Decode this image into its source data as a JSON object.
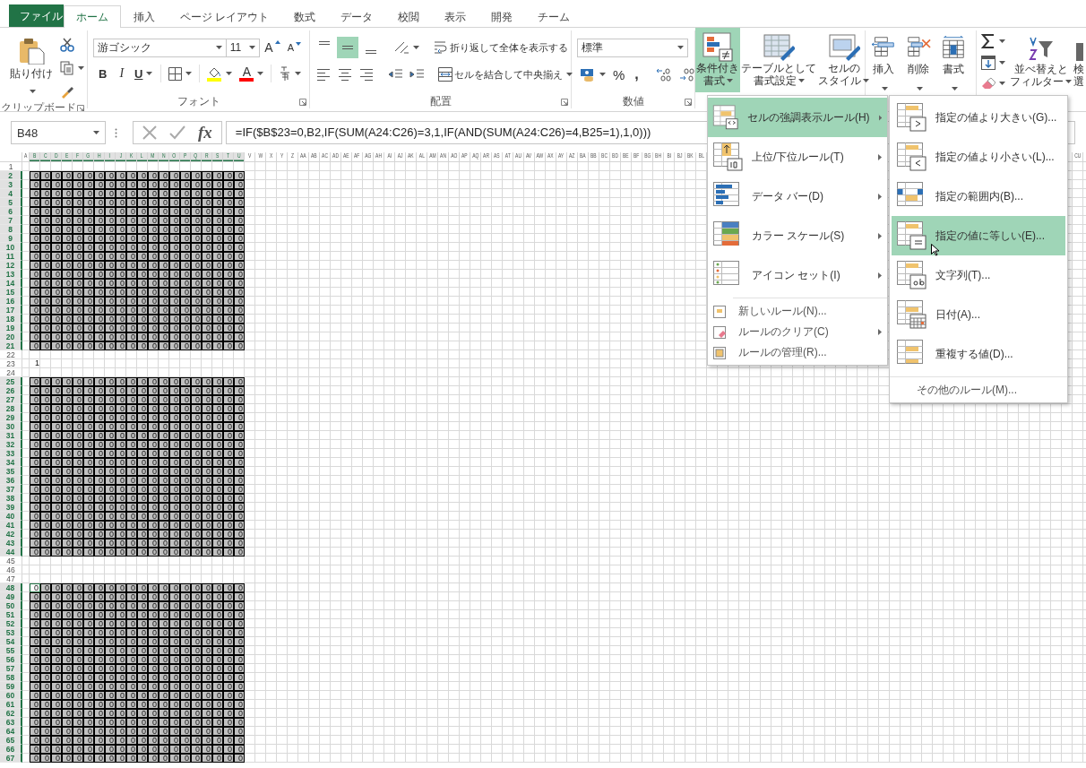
{
  "tabs": [
    {
      "label": "ファイル",
      "kind": "file",
      "selected": false
    },
    {
      "label": "ホーム",
      "kind": "tab",
      "selected": true
    },
    {
      "label": "挿入",
      "kind": "tab",
      "selected": false
    },
    {
      "label": "ページ レイアウト",
      "kind": "tab",
      "selected": false
    },
    {
      "label": "数式",
      "kind": "tab",
      "selected": false
    },
    {
      "label": "データ",
      "kind": "tab",
      "selected": false
    },
    {
      "label": "校閲",
      "kind": "tab",
      "selected": false
    },
    {
      "label": "表示",
      "kind": "tab",
      "selected": false
    },
    {
      "label": "開発",
      "kind": "tab",
      "selected": false
    },
    {
      "label": "チーム",
      "kind": "tab",
      "selected": false
    }
  ],
  "ribbon": {
    "clipboard": {
      "paste": "貼り付け",
      "group_label": "クリップボード"
    },
    "font": {
      "font_name": "游ゴシック",
      "font_size": "11",
      "grow": "A",
      "shrink": "A",
      "bold": "B",
      "italic": "I",
      "underline": "U",
      "font_color": "A",
      "group_label": "フォント"
    },
    "alignment": {
      "vertical": [
        {
          "selected": false
        },
        {
          "selected": true
        },
        {
          "selected": false
        }
      ],
      "wrap_text": "折り返して全体を表示する",
      "merge": "セルを結合して中央揃え",
      "group_label": "配置"
    },
    "number": {
      "format": "標準",
      "percent": "%",
      "comma": ",",
      "group_label": "数値"
    },
    "styles": [
      {
        "lines": [
          "条件付き",
          "書式"
        ],
        "selected": true
      },
      {
        "lines": [
          "テーブルとして",
          "書式設定"
        ],
        "selected": false
      },
      {
        "lines": [
          "セルの",
          "スタイル"
        ],
        "selected": false
      }
    ],
    "cells": [
      {
        "label": "挿入"
      },
      {
        "label": "削除"
      },
      {
        "label": "書式"
      }
    ],
    "editing": {
      "sort": [
        "並べ替えと",
        "フィルター"
      ],
      "find": [
        "検",
        "選"
      ]
    }
  },
  "formula_bar": {
    "name_box": "B48",
    "function_label": "fx",
    "formula": "=IF($B$23=0,B2,IF(SUM(A24:C26)=3,1,IF(AND(SUM(A24:C26)=4,B25=1),1,0)))"
  },
  "sheet": {
    "column_headers_left": [
      {
        "label": "A",
        "highlighted": false
      },
      {
        "label": "B",
        "highlighted": true
      },
      {
        "label": "C",
        "highlighted": true
      },
      {
        "label": "D",
        "highlighted": true
      },
      {
        "label": "E",
        "highlighted": true
      },
      {
        "label": "F",
        "highlighted": true
      },
      {
        "label": "G",
        "highlighted": true
      },
      {
        "label": "H",
        "highlighted": true
      },
      {
        "label": "I",
        "highlighted": true
      },
      {
        "label": "J",
        "highlighted": true
      },
      {
        "label": "K",
        "highlighted": true
      },
      {
        "label": "L",
        "highlighted": true
      },
      {
        "label": "M",
        "highlighted": true
      },
      {
        "label": "N",
        "highlighted": true
      },
      {
        "label": "O",
        "highlighted": true
      },
      {
        "label": "P",
        "highlighted": true
      },
      {
        "label": "Q",
        "highlighted": true
      },
      {
        "label": "R",
        "highlighted": true
      },
      {
        "label": "S",
        "highlighted": true
      },
      {
        "label": "T",
        "highlighted": true
      },
      {
        "label": "U",
        "highlighted": true
      },
      {
        "label": "V",
        "highlighted": false
      },
      {
        "label": "W",
        "highlighted": false
      },
      {
        "label": "X",
        "highlighted": false
      },
      {
        "label": "Y",
        "highlighted": false
      },
      {
        "label": "Z",
        "highlighted": false
      },
      {
        "label": "AA",
        "highlighted": false
      },
      {
        "label": "AB",
        "highlighted": false
      },
      {
        "label": "AC",
        "highlighted": false
      },
      {
        "label": "AD",
        "highlighted": false
      },
      {
        "label": "AE",
        "highlighted": false
      },
      {
        "label": "AF",
        "highlighted": false
      },
      {
        "label": "AG",
        "highlighted": false
      },
      {
        "label": "AH",
        "highlighted": false
      },
      {
        "label": "AI",
        "highlighted": false
      },
      {
        "label": "AJ",
        "highlighted": false
      },
      {
        "label": "AK",
        "highlighted": false
      },
      {
        "label": "AL",
        "highlighted": false
      },
      {
        "label": "AM",
        "highlighted": false
      },
      {
        "label": "AN",
        "highlighted": false
      },
      {
        "label": "AO",
        "highlighted": false
      },
      {
        "label": "AP",
        "highlighted": false
      },
      {
        "label": "AQ",
        "highlighted": false
      },
      {
        "label": "AR",
        "highlighted": false
      },
      {
        "label": "AS",
        "highlighted": false
      },
      {
        "label": "AT",
        "highlighted": false
      },
      {
        "label": "AU",
        "highlighted": false
      },
      {
        "label": "AV",
        "highlighted": false
      },
      {
        "label": "AW",
        "highlighted": false
      },
      {
        "label": "AX",
        "highlighted": false
      },
      {
        "label": "AY",
        "highlighted": false
      },
      {
        "label": "AZ",
        "highlighted": false
      },
      {
        "label": "BA",
        "highlighted": false
      },
      {
        "label": "BB",
        "highlighted": false
      },
      {
        "label": "BC",
        "highlighted": false
      },
      {
        "label": "BD",
        "highlighted": false
      },
      {
        "label": "BE",
        "highlighted": false
      },
      {
        "label": "BF",
        "highlighted": false
      },
      {
        "label": "BG",
        "highlighted": false
      },
      {
        "label": "BH",
        "highlighted": false
      },
      {
        "label": "BI",
        "highlighted": false
      },
      {
        "label": "BJ",
        "highlighted": false
      },
      {
        "label": "BK",
        "highlighted": false
      },
      {
        "label": "BL",
        "highlighted": false
      }
    ],
    "column_headers_right": [
      {
        "label": "CU",
        "highlighted": false
      }
    ],
    "rows": [
      {
        "header": "1",
        "highlighted": false,
        "shaded": false
      },
      {
        "header": "2",
        "highlighted": true,
        "shaded": true,
        "first_cell_selected": false,
        "cells": [
          "0",
          "0",
          "0",
          "0",
          "0",
          "0",
          "0",
          "0",
          "0",
          "0",
          "0",
          "0",
          "0",
          "0",
          "0",
          "0",
          "0",
          "0",
          "0",
          "0"
        ]
      },
      {
        "header": "3",
        "highlighted": true,
        "shaded": true,
        "first_cell_selected": false,
        "cells": [
          "0",
          "0",
          "0",
          "0",
          "0",
          "0",
          "0",
          "0",
          "0",
          "0",
          "0",
          "0",
          "0",
          "0",
          "0",
          "0",
          "0",
          "0",
          "0",
          "0"
        ]
      },
      {
        "header": "4",
        "highlighted": true,
        "shaded": true,
        "first_cell_selected": false,
        "cells": [
          "0",
          "0",
          "0",
          "0",
          "0",
          "0",
          "0",
          "0",
          "0",
          "0",
          "0",
          "0",
          "0",
          "0",
          "0",
          "0",
          "0",
          "0",
          "0",
          "0"
        ]
      },
      {
        "header": "5",
        "highlighted": true,
        "shaded": true,
        "first_cell_selected": false,
        "cells": [
          "0",
          "0",
          "0",
          "0",
          "0",
          "0",
          "0",
          "0",
          "0",
          "0",
          "0",
          "0",
          "0",
          "0",
          "0",
          "0",
          "0",
          "0",
          "0",
          "0"
        ]
      },
      {
        "header": "6",
        "highlighted": true,
        "shaded": true,
        "first_cell_selected": false,
        "cells": [
          "0",
          "0",
          "0",
          "0",
          "0",
          "0",
          "0",
          "0",
          "0",
          "0",
          "0",
          "0",
          "0",
          "0",
          "0",
          "0",
          "0",
          "0",
          "0",
          "0"
        ]
      },
      {
        "header": "7",
        "highlighted": true,
        "shaded": true,
        "first_cell_selected": false,
        "cells": [
          "0",
          "0",
          "0",
          "0",
          "0",
          "0",
          "0",
          "0",
          "0",
          "0",
          "0",
          "0",
          "0",
          "0",
          "0",
          "0",
          "0",
          "0",
          "0",
          "0"
        ]
      },
      {
        "header": "8",
        "highlighted": true,
        "shaded": true,
        "first_cell_selected": false,
        "cells": [
          "0",
          "0",
          "0",
          "0",
          "0",
          "0",
          "0",
          "0",
          "0",
          "0",
          "0",
          "0",
          "0",
          "0",
          "0",
          "0",
          "0",
          "0",
          "0",
          "0"
        ]
      },
      {
        "header": "9",
        "highlighted": true,
        "shaded": true,
        "first_cell_selected": false,
        "cells": [
          "0",
          "0",
          "0",
          "0",
          "0",
          "0",
          "0",
          "0",
          "0",
          "0",
          "0",
          "0",
          "0",
          "0",
          "0",
          "0",
          "0",
          "0",
          "0",
          "0"
        ]
      },
      {
        "header": "10",
        "highlighted": true,
        "shaded": true,
        "first_cell_selected": false,
        "cells": [
          "0",
          "0",
          "0",
          "0",
          "0",
          "0",
          "0",
          "0",
          "0",
          "0",
          "0",
          "0",
          "0",
          "0",
          "0",
          "0",
          "0",
          "0",
          "0",
          "0"
        ]
      },
      {
        "header": "11",
        "highlighted": true,
        "shaded": true,
        "first_cell_selected": false,
        "cells": [
          "0",
          "0",
          "0",
          "0",
          "0",
          "0",
          "0",
          "0",
          "0",
          "0",
          "0",
          "0",
          "0",
          "0",
          "0",
          "0",
          "0",
          "0",
          "0",
          "0"
        ]
      },
      {
        "header": "12",
        "highlighted": true,
        "shaded": true,
        "first_cell_selected": false,
        "cells": [
          "0",
          "0",
          "0",
          "0",
          "0",
          "0",
          "0",
          "0",
          "0",
          "0",
          "0",
          "0",
          "0",
          "0",
          "0",
          "0",
          "0",
          "0",
          "0",
          "0"
        ]
      },
      {
        "header": "13",
        "highlighted": true,
        "shaded": true,
        "first_cell_selected": false,
        "cells": [
          "0",
          "0",
          "0",
          "0",
          "0",
          "0",
          "0",
          "0",
          "0",
          "0",
          "0",
          "0",
          "0",
          "0",
          "0",
          "0",
          "0",
          "0",
          "0",
          "0"
        ]
      },
      {
        "header": "14",
        "highlighted": true,
        "shaded": true,
        "first_cell_selected": false,
        "cells": [
          "0",
          "0",
          "0",
          "0",
          "0",
          "0",
          "0",
          "0",
          "0",
          "0",
          "0",
          "0",
          "0",
          "0",
          "0",
          "0",
          "0",
          "0",
          "0",
          "0"
        ]
      },
      {
        "header": "15",
        "highlighted": true,
        "shaded": true,
        "first_cell_selected": false,
        "cells": [
          "0",
          "0",
          "0",
          "0",
          "0",
          "0",
          "0",
          "0",
          "0",
          "0",
          "0",
          "0",
          "0",
          "0",
          "0",
          "0",
          "0",
          "0",
          "0",
          "0"
        ]
      },
      {
        "header": "16",
        "highlighted": true,
        "shaded": true,
        "first_cell_selected": false,
        "cells": [
          "0",
          "0",
          "0",
          "0",
          "0",
          "0",
          "0",
          "0",
          "0",
          "0",
          "0",
          "0",
          "0",
          "0",
          "0",
          "0",
          "0",
          "0",
          "0",
          "0"
        ]
      },
      {
        "header": "17",
        "highlighted": true,
        "shaded": true,
        "first_cell_selected": false,
        "cells": [
          "0",
          "0",
          "0",
          "0",
          "0",
          "0",
          "0",
          "0",
          "0",
          "0",
          "0",
          "0",
          "0",
          "0",
          "0",
          "0",
          "0",
          "0",
          "0",
          "0"
        ]
      },
      {
        "header": "18",
        "highlighted": true,
        "shaded": true,
        "first_cell_selected": false,
        "cells": [
          "0",
          "0",
          "0",
          "0",
          "0",
          "0",
          "0",
          "0",
          "0",
          "0",
          "0",
          "0",
          "0",
          "0",
          "0",
          "0",
          "0",
          "0",
          "0",
          "0"
        ]
      },
      {
        "header": "19",
        "highlighted": true,
        "shaded": true,
        "first_cell_selected": false,
        "cells": [
          "0",
          "0",
          "0",
          "0",
          "0",
          "0",
          "0",
          "0",
          "0",
          "0",
          "0",
          "0",
          "0",
          "0",
          "0",
          "0",
          "0",
          "0",
          "0",
          "0"
        ]
      },
      {
        "header": "20",
        "highlighted": true,
        "shaded": true,
        "first_cell_selected": false,
        "cells": [
          "0",
          "0",
          "0",
          "0",
          "0",
          "0",
          "0",
          "0",
          "0",
          "0",
          "0",
          "0",
          "0",
          "0",
          "0",
          "0",
          "0",
          "0",
          "0",
          "0"
        ]
      },
      {
        "header": "21",
        "highlighted": true,
        "shaded": true,
        "first_cell_selected": false,
        "cells": [
          "0",
          "0",
          "0",
          "0",
          "0",
          "0",
          "0",
          "0",
          "0",
          "0",
          "0",
          "0",
          "0",
          "0",
          "0",
          "0",
          "0",
          "0",
          "0",
          "0"
        ]
      },
      {
        "header": "22",
        "highlighted": false,
        "shaded": false
      },
      {
        "header": "23",
        "highlighted": false,
        "shaded": false,
        "first_cell_selected": false,
        "cells": [
          "1"
        ]
      },
      {
        "header": "24",
        "highlighted": false,
        "shaded": false
      },
      {
        "header": "25",
        "highlighted": true,
        "shaded": true,
        "first_cell_selected": false,
        "cells": [
          "0",
          "0",
          "0",
          "0",
          "0",
          "0",
          "0",
          "0",
          "0",
          "0",
          "0",
          "0",
          "0",
          "0",
          "0",
          "0",
          "0",
          "0",
          "0",
          "0"
        ]
      },
      {
        "header": "26",
        "highlighted": true,
        "shaded": true,
        "first_cell_selected": false,
        "cells": [
          "0",
          "0",
          "0",
          "0",
          "0",
          "0",
          "0",
          "0",
          "0",
          "0",
          "0",
          "0",
          "0",
          "0",
          "0",
          "0",
          "0",
          "0",
          "0",
          "0"
        ]
      },
      {
        "header": "27",
        "highlighted": true,
        "shaded": true,
        "first_cell_selected": false,
        "cells": [
          "0",
          "0",
          "0",
          "0",
          "0",
          "0",
          "0",
          "0",
          "0",
          "0",
          "0",
          "0",
          "0",
          "0",
          "0",
          "0",
          "0",
          "0",
          "0",
          "0"
        ]
      },
      {
        "header": "28",
        "highlighted": true,
        "shaded": true,
        "first_cell_selected": false,
        "cells": [
          "0",
          "0",
          "0",
          "0",
          "0",
          "0",
          "0",
          "0",
          "0",
          "0",
          "0",
          "0",
          "0",
          "0",
          "0",
          "0",
          "0",
          "0",
          "0",
          "0"
        ]
      },
      {
        "header": "29",
        "highlighted": true,
        "shaded": true,
        "first_cell_selected": false,
        "cells": [
          "0",
          "0",
          "0",
          "0",
          "0",
          "0",
          "0",
          "0",
          "0",
          "0",
          "0",
          "0",
          "0",
          "0",
          "0",
          "0",
          "0",
          "0",
          "0",
          "0"
        ]
      },
      {
        "header": "30",
        "highlighted": true,
        "shaded": true,
        "first_cell_selected": false,
        "cells": [
          "0",
          "0",
          "0",
          "0",
          "0",
          "0",
          "0",
          "0",
          "0",
          "0",
          "0",
          "0",
          "0",
          "0",
          "0",
          "0",
          "0",
          "0",
          "0",
          "0"
        ]
      },
      {
        "header": "31",
        "highlighted": true,
        "shaded": true,
        "first_cell_selected": false,
        "cells": [
          "0",
          "0",
          "0",
          "0",
          "0",
          "0",
          "0",
          "0",
          "0",
          "0",
          "0",
          "0",
          "0",
          "0",
          "0",
          "0",
          "0",
          "0",
          "0",
          "0"
        ]
      },
      {
        "header": "32",
        "highlighted": true,
        "shaded": true,
        "first_cell_selected": false,
        "cells": [
          "0",
          "0",
          "0",
          "0",
          "0",
          "0",
          "0",
          "0",
          "0",
          "0",
          "0",
          "0",
          "0",
          "0",
          "0",
          "0",
          "0",
          "0",
          "0",
          "0"
        ]
      },
      {
        "header": "33",
        "highlighted": true,
        "shaded": true,
        "first_cell_selected": false,
        "cells": [
          "0",
          "0",
          "0",
          "0",
          "0",
          "0",
          "0",
          "0",
          "0",
          "0",
          "0",
          "0",
          "0",
          "0",
          "0",
          "0",
          "0",
          "0",
          "0",
          "0"
        ]
      },
      {
        "header": "34",
        "highlighted": true,
        "shaded": true,
        "first_cell_selected": false,
        "cells": [
          "0",
          "0",
          "0",
          "0",
          "0",
          "0",
          "0",
          "0",
          "0",
          "0",
          "0",
          "0",
          "0",
          "0",
          "0",
          "0",
          "0",
          "0",
          "0",
          "0"
        ]
      },
      {
        "header": "35",
        "highlighted": true,
        "shaded": true,
        "first_cell_selected": false,
        "cells": [
          "0",
          "0",
          "0",
          "0",
          "0",
          "0",
          "0",
          "0",
          "0",
          "0",
          "0",
          "0",
          "0",
          "0",
          "0",
          "0",
          "0",
          "0",
          "0",
          "0"
        ]
      },
      {
        "header": "36",
        "highlighted": true,
        "shaded": true,
        "first_cell_selected": false,
        "cells": [
          "0",
          "0",
          "0",
          "0",
          "0",
          "0",
          "0",
          "0",
          "0",
          "0",
          "0",
          "0",
          "0",
          "0",
          "0",
          "0",
          "0",
          "0",
          "0",
          "0"
        ]
      },
      {
        "header": "37",
        "highlighted": true,
        "shaded": true,
        "first_cell_selected": false,
        "cells": [
          "0",
          "0",
          "0",
          "0",
          "0",
          "0",
          "0",
          "0",
          "0",
          "0",
          "0",
          "0",
          "0",
          "0",
          "0",
          "0",
          "0",
          "0",
          "0",
          "0"
        ]
      },
      {
        "header": "38",
        "highlighted": true,
        "shaded": true,
        "first_cell_selected": false,
        "cells": [
          "0",
          "0",
          "0",
          "0",
          "0",
          "0",
          "0",
          "0",
          "0",
          "0",
          "0",
          "0",
          "0",
          "0",
          "0",
          "0",
          "0",
          "0",
          "0",
          "0"
        ]
      },
      {
        "header": "39",
        "highlighted": true,
        "shaded": true,
        "first_cell_selected": false,
        "cells": [
          "0",
          "0",
          "0",
          "0",
          "0",
          "0",
          "0",
          "0",
          "0",
          "0",
          "0",
          "0",
          "0",
          "0",
          "0",
          "0",
          "0",
          "0",
          "0",
          "0"
        ]
      },
      {
        "header": "40",
        "highlighted": true,
        "shaded": true,
        "first_cell_selected": false,
        "cells": [
          "0",
          "0",
          "0",
          "0",
          "0",
          "0",
          "0",
          "0",
          "0",
          "0",
          "0",
          "0",
          "0",
          "0",
          "0",
          "0",
          "0",
          "0",
          "0",
          "0"
        ]
      },
      {
        "header": "41",
        "highlighted": true,
        "shaded": true,
        "first_cell_selected": false,
        "cells": [
          "0",
          "0",
          "0",
          "0",
          "0",
          "0",
          "0",
          "0",
          "0",
          "0",
          "0",
          "0",
          "0",
          "0",
          "0",
          "0",
          "0",
          "0",
          "0",
          "0"
        ]
      },
      {
        "header": "42",
        "highlighted": true,
        "shaded": true,
        "first_cell_selected": false,
        "cells": [
          "0",
          "0",
          "0",
          "0",
          "0",
          "0",
          "0",
          "0",
          "0",
          "0",
          "0",
          "0",
          "0",
          "0",
          "0",
          "0",
          "0",
          "0",
          "0",
          "0"
        ]
      },
      {
        "header": "43",
        "highlighted": true,
        "shaded": true,
        "first_cell_selected": false,
        "cells": [
          "0",
          "0",
          "0",
          "0",
          "0",
          "0",
          "0",
          "0",
          "0",
          "0",
          "0",
          "0",
          "0",
          "0",
          "0",
          "0",
          "0",
          "0",
          "0",
          "0"
        ]
      },
      {
        "header": "44",
        "highlighted": true,
        "shaded": true,
        "first_cell_selected": false,
        "cells": [
          "0",
          "0",
          "0",
          "0",
          "0",
          "0",
          "0",
          "0",
          "0",
          "0",
          "0",
          "0",
          "0",
          "0",
          "0",
          "0",
          "0",
          "0",
          "0",
          "0"
        ]
      },
      {
        "header": "45",
        "highlighted": false,
        "shaded": false
      },
      {
        "header": "46",
        "highlighted": false,
        "shaded": false
      },
      {
        "header": "47",
        "highlighted": false,
        "shaded": false
      },
      {
        "header": "48",
        "highlighted": true,
        "shaded": true,
        "first_cell_selected": true,
        "cells": [
          "0",
          "0",
          "0",
          "0",
          "0",
          "0",
          "0",
          "0",
          "0",
          "0",
          "0",
          "0",
          "0",
          "0",
          "0",
          "0",
          "0",
          "0",
          "0",
          "0"
        ]
      },
      {
        "header": "49",
        "highlighted": true,
        "shaded": true,
        "first_cell_selected": false,
        "cells": [
          "0",
          "0",
          "0",
          "0",
          "0",
          "0",
          "0",
          "0",
          "0",
          "0",
          "0",
          "0",
          "0",
          "0",
          "0",
          "0",
          "0",
          "0",
          "0",
          "0"
        ]
      },
      {
        "header": "50",
        "highlighted": true,
        "shaded": true,
        "first_cell_selected": false,
        "cells": [
          "0",
          "0",
          "0",
          "0",
          "0",
          "0",
          "0",
          "0",
          "0",
          "0",
          "0",
          "0",
          "0",
          "0",
          "0",
          "0",
          "0",
          "0",
          "0",
          "0"
        ]
      },
      {
        "header": "51",
        "highlighted": true,
        "shaded": true,
        "first_cell_selected": false,
        "cells": [
          "0",
          "0",
          "0",
          "0",
          "0",
          "0",
          "0",
          "0",
          "0",
          "0",
          "0",
          "0",
          "0",
          "0",
          "0",
          "0",
          "0",
          "0",
          "0",
          "0"
        ]
      },
      {
        "header": "52",
        "highlighted": true,
        "shaded": true,
        "first_cell_selected": false,
        "cells": [
          "0",
          "0",
          "0",
          "0",
          "0",
          "0",
          "0",
          "0",
          "0",
          "0",
          "0",
          "0",
          "0",
          "0",
          "0",
          "0",
          "0",
          "0",
          "0",
          "0"
        ]
      },
      {
        "header": "53",
        "highlighted": true,
        "shaded": true,
        "first_cell_selected": false,
        "cells": [
          "0",
          "0",
          "0",
          "0",
          "0",
          "0",
          "0",
          "0",
          "0",
          "0",
          "0",
          "0",
          "0",
          "0",
          "0",
          "0",
          "0",
          "0",
          "0",
          "0"
        ]
      },
      {
        "header": "54",
        "highlighted": true,
        "shaded": true,
        "first_cell_selected": false,
        "cells": [
          "0",
          "0",
          "0",
          "0",
          "0",
          "0",
          "0",
          "0",
          "0",
          "0",
          "0",
          "0",
          "0",
          "0",
          "0",
          "0",
          "0",
          "0",
          "0",
          "0"
        ]
      },
      {
        "header": "55",
        "highlighted": true,
        "shaded": true,
        "first_cell_selected": false,
        "cells": [
          "0",
          "0",
          "0",
          "0",
          "0",
          "0",
          "0",
          "0",
          "0",
          "0",
          "0",
          "0",
          "0",
          "0",
          "0",
          "0",
          "0",
          "0",
          "0",
          "0"
        ]
      },
      {
        "header": "56",
        "highlighted": true,
        "shaded": true,
        "first_cell_selected": false,
        "cells": [
          "0",
          "0",
          "0",
          "0",
          "0",
          "0",
          "0",
          "0",
          "0",
          "0",
          "0",
          "0",
          "0",
          "0",
          "0",
          "0",
          "0",
          "0",
          "0",
          "0"
        ]
      },
      {
        "header": "57",
        "highlighted": true,
        "shaded": true,
        "first_cell_selected": false,
        "cells": [
          "0",
          "0",
          "0",
          "0",
          "0",
          "0",
          "0",
          "0",
          "0",
          "0",
          "0",
          "0",
          "0",
          "0",
          "0",
          "0",
          "0",
          "0",
          "0",
          "0"
        ]
      },
      {
        "header": "58",
        "highlighted": true,
        "shaded": true,
        "first_cell_selected": false,
        "cells": [
          "0",
          "0",
          "0",
          "0",
          "0",
          "0",
          "0",
          "0",
          "0",
          "0",
          "0",
          "0",
          "0",
          "0",
          "0",
          "0",
          "0",
          "0",
          "0",
          "0"
        ]
      },
      {
        "header": "59",
        "highlighted": true,
        "shaded": true,
        "first_cell_selected": false,
        "cells": [
          "0",
          "0",
          "0",
          "0",
          "0",
          "0",
          "0",
          "0",
          "0",
          "0",
          "0",
          "0",
          "0",
          "0",
          "0",
          "0",
          "0",
          "0",
          "0",
          "0"
        ]
      },
      {
        "header": "60",
        "highlighted": true,
        "shaded": true,
        "first_cell_selected": false,
        "cells": [
          "0",
          "0",
          "0",
          "0",
          "0",
          "0",
          "0",
          "0",
          "0",
          "0",
          "0",
          "0",
          "0",
          "0",
          "0",
          "0",
          "0",
          "0",
          "0",
          "0"
        ]
      },
      {
        "header": "61",
        "highlighted": true,
        "shaded": true,
        "first_cell_selected": false,
        "cells": [
          "0",
          "0",
          "0",
          "0",
          "0",
          "0",
          "0",
          "0",
          "0",
          "0",
          "0",
          "0",
          "0",
          "0",
          "0",
          "0",
          "0",
          "0",
          "0",
          "0"
        ]
      },
      {
        "header": "62",
        "highlighted": true,
        "shaded": true,
        "first_cell_selected": false,
        "cells": [
          "0",
          "0",
          "0",
          "0",
          "0",
          "0",
          "0",
          "0",
          "0",
          "0",
          "0",
          "0",
          "0",
          "0",
          "0",
          "0",
          "0",
          "0",
          "0",
          "0"
        ]
      },
      {
        "header": "63",
        "highlighted": true,
        "shaded": true,
        "first_cell_selected": false,
        "cells": [
          "0",
          "0",
          "0",
          "0",
          "0",
          "0",
          "0",
          "0",
          "0",
          "0",
          "0",
          "0",
          "0",
          "0",
          "0",
          "0",
          "0",
          "0",
          "0",
          "0"
        ]
      },
      {
        "header": "64",
        "highlighted": true,
        "shaded": true,
        "first_cell_selected": false,
        "cells": [
          "0",
          "0",
          "0",
          "0",
          "0",
          "0",
          "0",
          "0",
          "0",
          "0",
          "0",
          "0",
          "0",
          "0",
          "0",
          "0",
          "0",
          "0",
          "0",
          "0"
        ]
      },
      {
        "header": "65",
        "highlighted": true,
        "shaded": true,
        "first_cell_selected": false,
        "cells": [
          "0",
          "0",
          "0",
          "0",
          "0",
          "0",
          "0",
          "0",
          "0",
          "0",
          "0",
          "0",
          "0",
          "0",
          "0",
          "0",
          "0",
          "0",
          "0",
          "0"
        ]
      },
      {
        "header": "66",
        "highlighted": true,
        "shaded": true,
        "first_cell_selected": false,
        "cells": [
          "0",
          "0",
          "0",
          "0",
          "0",
          "0",
          "0",
          "0",
          "0",
          "0",
          "0",
          "0",
          "0",
          "0",
          "0",
          "0",
          "0",
          "0",
          "0",
          "0"
        ]
      },
      {
        "header": "67",
        "highlighted": true,
        "shaded": true,
        "first_cell_selected": false,
        "cells": [
          "0",
          "0",
          "0",
          "0",
          "0",
          "0",
          "0",
          "0",
          "0",
          "0",
          "0",
          "0",
          "0",
          "0",
          "0",
          "0",
          "0",
          "0",
          "0",
          "0"
        ]
      }
    ]
  },
  "conditional_format_menu": {
    "items": [
      {
        "kind": "large",
        "label": "セルの強調表示ルール(H)",
        "submenu": true,
        "selected": true
      },
      {
        "kind": "large",
        "label": "上位/下位ルール(T)",
        "submenu": true,
        "selected": false
      },
      {
        "kind": "large",
        "label": "データ バー(D)",
        "submenu": true,
        "selected": false
      },
      {
        "kind": "large",
        "label": "カラー スケール(S)",
        "submenu": true,
        "selected": false
      },
      {
        "kind": "large",
        "label": "アイコン セット(I)",
        "submenu": true,
        "selected": false
      },
      {
        "kind": "small",
        "label": "新しいルール(N)...",
        "submenu": false,
        "selected": false
      },
      {
        "kind": "small",
        "label": "ルールのクリア(C)",
        "submenu": true,
        "selected": false
      },
      {
        "kind": "small",
        "label": "ルールの管理(R)...",
        "submenu": false,
        "selected": false
      }
    ]
  },
  "highlight_rules_submenu": {
    "items": [
      {
        "kind": "large",
        "label": "指定の値より大きい(G)...",
        "selected": false
      },
      {
        "kind": "large",
        "label": "指定の値より小さい(L)...",
        "selected": false
      },
      {
        "kind": "large",
        "label": "指定の範囲内(B)...",
        "selected": false
      },
      {
        "kind": "large",
        "label": "指定の値に等しい(E)...",
        "selected": true
      },
      {
        "kind": "large",
        "label": "文字列(T)...",
        "selected": false
      },
      {
        "kind": "large",
        "label": "日付(A)...",
        "selected": false
      },
      {
        "kind": "large",
        "label": "重複する値(D)...",
        "selected": false
      },
      {
        "kind": "small",
        "label": "その他のルール(M)...",
        "selected": false
      }
    ]
  }
}
